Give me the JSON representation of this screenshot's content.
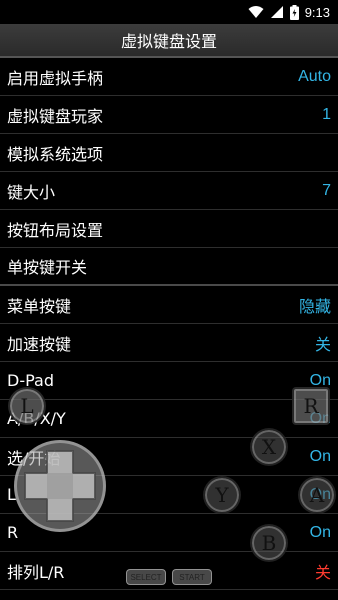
{
  "status_bar": {
    "time": "9:13",
    "icons": [
      "wifi-icon",
      "signal-icon",
      "battery-icon"
    ]
  },
  "title": "虚拟键盘设置",
  "menu": [
    {
      "label": "启用虚拟手柄",
      "value": "Auto"
    },
    {
      "label": "虚拟键盘玩家",
      "value": "1"
    },
    {
      "label": "模拟系统选项",
      "value": ""
    },
    {
      "label": "键大小",
      "value": "7"
    },
    {
      "label": "按钮布局设置",
      "value": ""
    },
    {
      "label": "单按键开关",
      "value": ""
    },
    {
      "label": "菜单按键",
      "value": "隐藏"
    },
    {
      "label": "加速按键",
      "value": "关"
    },
    {
      "label": "D-Pad",
      "value": "On"
    },
    {
      "label": "A/B/X/Y",
      "value": "On"
    },
    {
      "label": "选/开始",
      "value": "On"
    },
    {
      "label": "L",
      "value": "On"
    },
    {
      "label": "R",
      "value": "On"
    },
    {
      "label": "排列L/R",
      "value": "关"
    }
  ],
  "gamepad": {
    "l_label": "L",
    "r_label": "R",
    "x_label": "X",
    "y_label": "Y",
    "a_label": "A",
    "b_label": "B",
    "select_label": "SELECT",
    "start_label": "START"
  },
  "colors": {
    "value_blue": "#33b5e5",
    "value_red": "#ff3b30",
    "title_bg": "#333333"
  }
}
